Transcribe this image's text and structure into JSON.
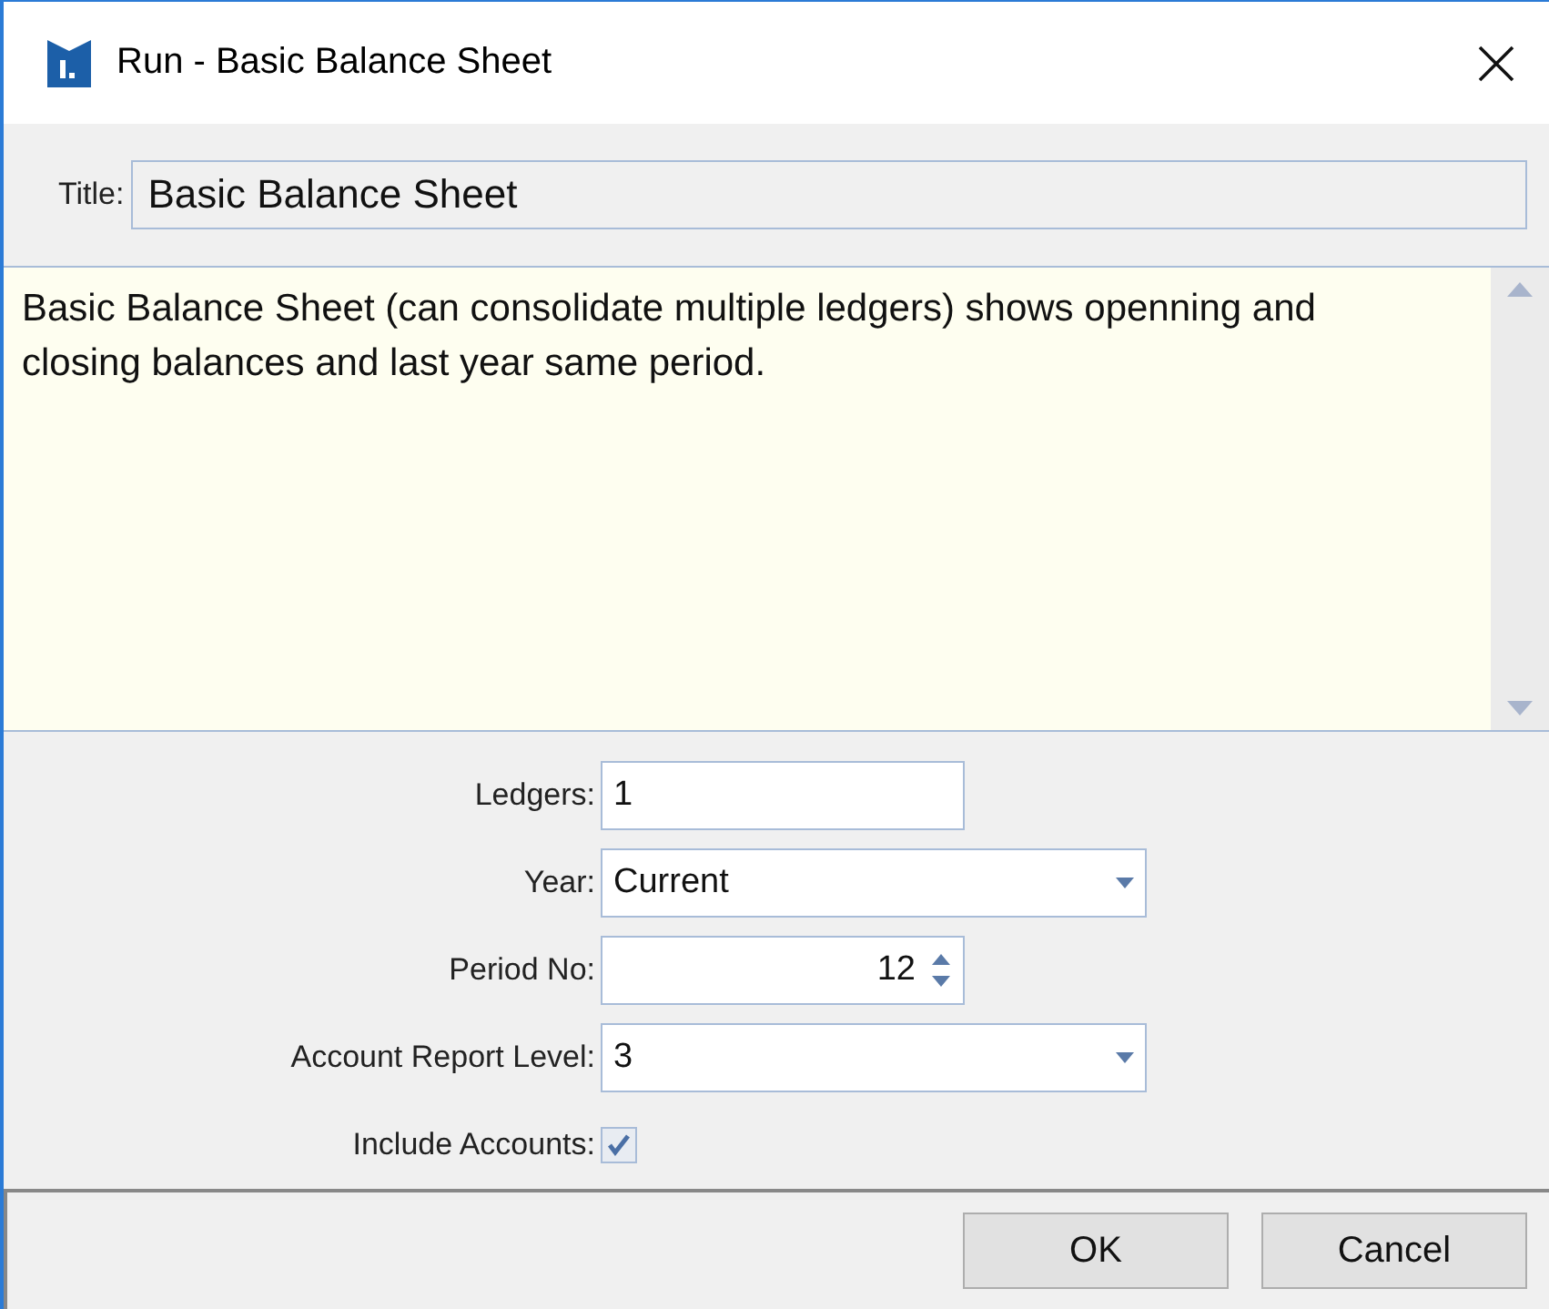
{
  "window": {
    "title": "Run - Basic Balance Sheet"
  },
  "title_field": {
    "label": "Title:",
    "value": "Basic Balance Sheet"
  },
  "description": "Basic Balance Sheet (can consolidate multiple ledgers) shows openning and closing balances and last year same period.",
  "fields": [
    {
      "kind": "text",
      "label": "Ledgers:",
      "value": "1"
    },
    {
      "kind": "dropdown",
      "label": "Year:",
      "value": "Current"
    },
    {
      "kind": "spinner",
      "label": "Period No:",
      "value": "12"
    },
    {
      "kind": "dropdown",
      "label": "Account Report Level:",
      "value": "3"
    },
    {
      "kind": "checkbox",
      "label": "Include Accounts:",
      "checked": true
    }
  ],
  "buttons": [
    "OK",
    "Cancel"
  ]
}
